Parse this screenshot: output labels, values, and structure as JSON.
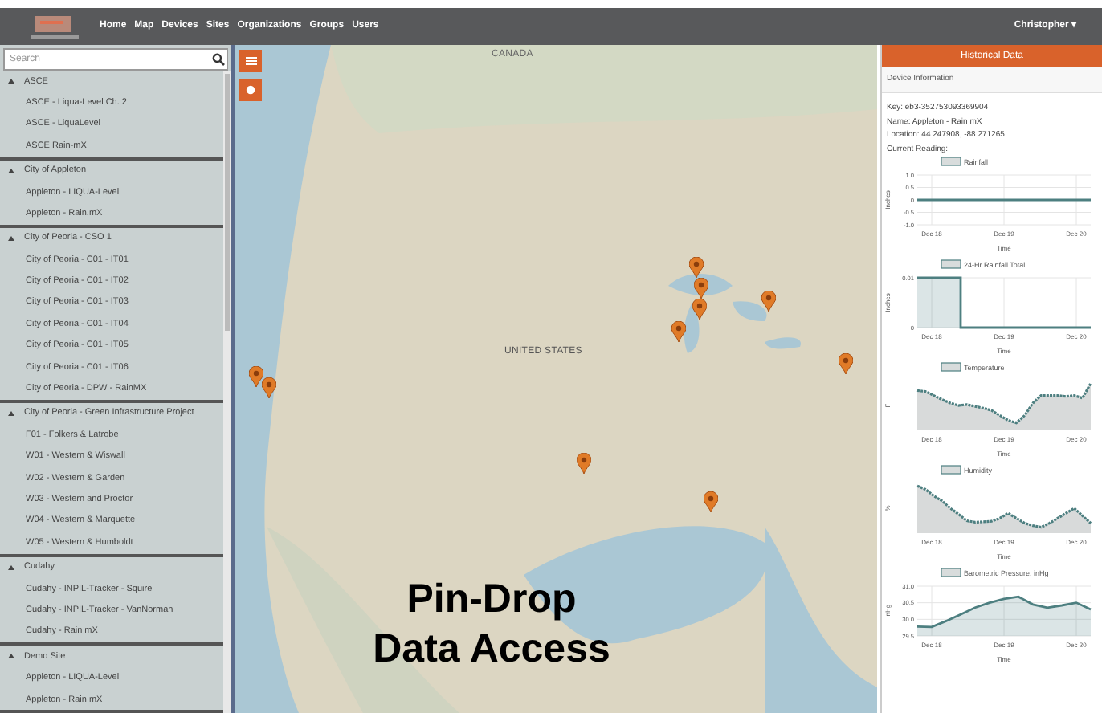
{
  "nav": {
    "links": [
      "Home",
      "Map",
      "Devices",
      "Sites",
      "Organizations",
      "Groups",
      "Users"
    ],
    "user": "Christopher ▾"
  },
  "sidebar": {
    "search": {
      "placeholder": "Search"
    },
    "groups": [
      {
        "name": "ASCE",
        "expanded": true,
        "items": [
          "ASCE - Liqua-Level Ch. 2",
          "ASCE - LiquaLevel",
          "ASCE Rain-mX"
        ]
      },
      {
        "name": "City of Appleton",
        "expanded": true,
        "items": [
          "Appleton - LIQUA-Level",
          "Appleton - Rain.mX"
        ]
      },
      {
        "name": "City of Peoria - CSO 1",
        "expanded": true,
        "items": [
          "City of Peoria - C01 - IT01",
          "City of Peoria - C01 - IT02",
          "City of Peoria - C01 - IT03",
          "City of Peoria - C01 - IT04",
          "City of Peoria - C01 - IT05",
          "City of Peoria - C01 - IT06",
          "City of Peoria - DPW - RainMX"
        ]
      },
      {
        "name": "City of Peoria - Green Infrastructure Project",
        "expanded": true,
        "items": [
          "F01 - Folkers & Latrobe",
          "W01 - Western & Wiswall",
          "W02 - Western & Garden",
          "W03 - Western and Proctor",
          "W04 - Western & Marquette",
          "W05 - Western & Humboldt"
        ]
      },
      {
        "name": "Cudahy",
        "expanded": true,
        "items": [
          "Cudahy - INPIL-Tracker - Squire",
          "Cudahy - INPIL-Tracker - VanNorman",
          "Cudahy - Rain mX"
        ]
      },
      {
        "name": "Demo Site",
        "expanded": true,
        "items": [
          "Appleton - LIQUA-Level",
          "Appleton - Rain mX"
        ]
      }
    ]
  },
  "map": {
    "labels": [
      "CANADA",
      "UNITED STATES"
    ],
    "caption": [
      "Pin-Drop",
      "Data Access"
    ]
  },
  "panel": {
    "title": "Historical Data",
    "section": "Device Information",
    "info": [
      "Key: eb3-352753093369904",
      "Name: Appleton - Rain mX",
      "Location: 44.247908, -88.271265",
      "Current Reading:"
    ],
    "charts": [
      {
        "kind": "chart",
        "chart_data": {
          "type": "line",
          "grid": true,
          "xlabel": "Time",
          "ylabel": "Inches",
          "categories": [
            null,
            "Dec 18",
            null,
            null,
            null,
            null,
            "Dec 19",
            null,
            null,
            null,
            null,
            "Dec 20",
            null
          ],
          "series": [
            {
              "name": "Rainfall",
              "color": "#4d7f80",
              "values": [
                0,
                0,
                0,
                0,
                0,
                0,
                0,
                0,
                0,
                0,
                0,
                0,
                0
              ]
            }
          ],
          "ylim": [
            -1,
            1
          ],
          "yticks": [
            {
              "value": -1,
              "label": "-1.0"
            },
            {
              "value": -0.5,
              "label": "-0.5"
            },
            {
              "value": 0,
              "label": "0"
            },
            {
              "value": 0.5,
              "label": "0.5"
            },
            {
              "value": 1,
              "label": "1.0"
            }
          ]
        }
      },
      {
        "kind": "chart",
        "chart_data": {
          "type": "area",
          "grid": true,
          "xlabel": "Time",
          "ylabel": "Inches",
          "categories": [
            null,
            "Dec 18",
            null,
            null,
            null,
            null,
            "Dec 19",
            null,
            null,
            null,
            null,
            "Dec 20",
            null
          ],
          "series": [
            {
              "name": "24-Hr Rainfall Total",
              "color": "#4d7f80",
              "values": [
                0.01,
                0.01,
                0.01,
                0,
                0,
                0,
                0,
                0,
                0,
                0,
                0,
                0,
                0
              ]
            }
          ],
          "ylim": [
            0,
            0.01
          ],
          "yticks": [
            {
              "value": 0,
              "label": "0"
            },
            {
              "value": 0.01,
              "label": "0.01"
            }
          ]
        }
      },
      {
        "kind": "sparkline",
        "title": "Temperature",
        "ylabel": "F",
        "xlabel": "Time",
        "xtick_labels": [
          "Dec 18",
          "Dec 19",
          "Dec 20"
        ]
      },
      {
        "kind": "sparkline",
        "title": "Humidity",
        "ylabel": "%",
        "xlabel": "Time",
        "xtick_labels": [
          "Dec 18",
          "Dec 19",
          "Dec 20"
        ]
      },
      {
        "kind": "chart",
        "chart_data": {
          "type": "area",
          "grid": true,
          "xlabel": "Time",
          "ylabel": "inHg",
          "categories": [
            null,
            "Dec 18",
            null,
            null,
            null,
            null,
            "Dec 19",
            null,
            null,
            null,
            null,
            "Dec 20",
            null
          ],
          "series": [
            {
              "name": "Barometric Pressure, inHg",
              "color": "#4d7f80",
              "values": [
                29.78,
                29.77,
                29.95,
                30.15,
                30.35,
                30.5,
                30.62,
                30.68,
                30.45,
                30.35,
                30.42,
                30.5,
                30.3
              ]
            }
          ],
          "ylim": [
            29.5,
            31
          ],
          "yticks": [
            {
              "value": 29.5,
              "label": "29.5"
            },
            {
              "value": 30,
              "label": "30.0"
            },
            {
              "value": 30.5,
              "label": "30.5"
            },
            {
              "value": 31,
              "label": "31.0"
            }
          ]
        }
      }
    ]
  }
}
